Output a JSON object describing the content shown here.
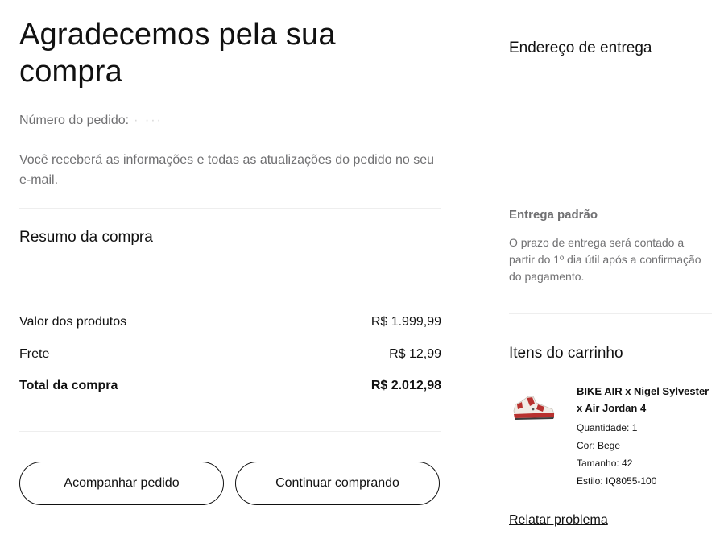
{
  "confirmation": {
    "title": "Agradecemos pela sua compra",
    "order_number_label": "Número do pedido:",
    "order_number_masked": "· ···",
    "info_text": "Você receberá as informações e todas as atualizações do pedido no seu e-mail."
  },
  "summary": {
    "title": "Resumo da compra",
    "rows": [
      {
        "label": "Valor dos produtos",
        "value": "R$ 1.999,99"
      },
      {
        "label": "Frete",
        "value": "R$ 12,99"
      },
      {
        "label": "Total da compra",
        "value": "R$ 2.012,98"
      }
    ]
  },
  "actions": {
    "track_order": "Acompanhar pedido",
    "continue_shopping": "Continuar comprando",
    "report_problem": "Relatar problema"
  },
  "shipping": {
    "title": "Endereço de entrega",
    "method": "Entrega padrão",
    "description": "O prazo de entrega será contado a partir do 1º dia útil após a confirmação do pagamento."
  },
  "cart": {
    "title": "Itens do carrinho",
    "items": [
      {
        "name": "BIKE AIR x Nigel Sylvester x Air Jordan 4",
        "quantity": "Quantidade: 1",
        "color": "Cor: Bege",
        "size": "Tamanho: 42",
        "style": "Estilo: IQ8055-100",
        "image_icon": "sneaker-image"
      }
    ]
  },
  "colors": {
    "text_primary": "#111111",
    "text_secondary": "#707072",
    "divider": "#eeeeee",
    "sneaker_red": "#b8312f"
  }
}
